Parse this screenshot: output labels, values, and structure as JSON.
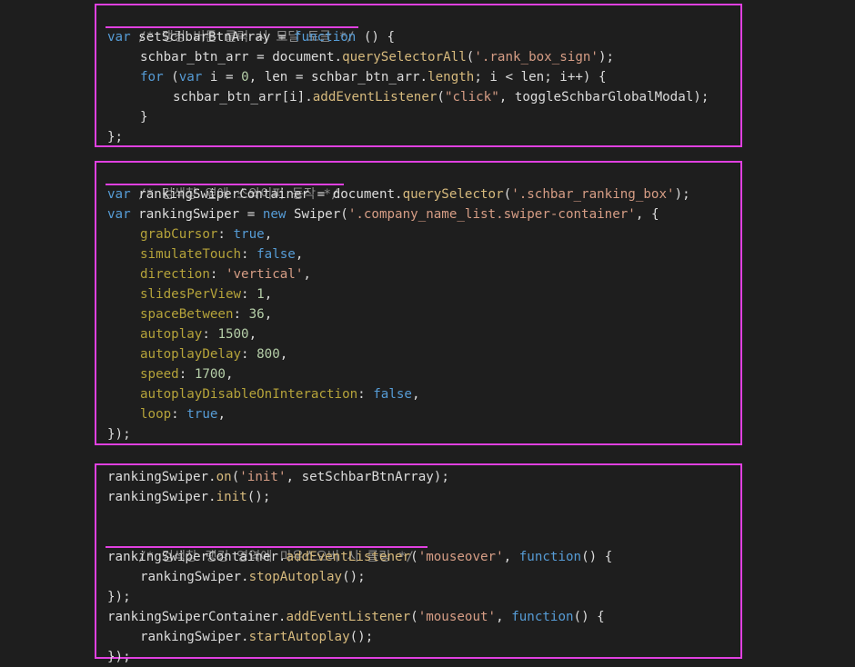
{
  "block1": {
    "comment": "/* 랭킹 버튼 클릭 시 모달 토글 */",
    "l1": {
      "kw": "var",
      "text": " setSchbarBtnArray = ",
      "kw2": "function",
      "rest": " () {"
    },
    "l2": {
      "a": "schbar_btn_arr = document.",
      "m": "querySelectorAll",
      "b": "(",
      "s": "'.rank_box_sign'",
      "c": ");"
    },
    "l3": {
      "kw": "for",
      "a": " (",
      "kw2": "var",
      "b": " i = ",
      "n": "0",
      "c": ", len = schbar_btn_arr.",
      "m": "length",
      "d": "; i < len; i++) {"
    },
    "l4": {
      "a": "schbar_btn_arr[i].",
      "m": "addEventListener",
      "b": "(",
      "s": "\"click\"",
      "c": ", toggleSchbarGlobalModal);"
    },
    "l5": "}",
    "l6": "};"
  },
  "block2": {
    "comment": "/* 검색창 옆에 스와이퍼 동작 */",
    "l1": {
      "kw": "var",
      "a": " rankingSwiperContainer = document.",
      "m": "querySelector",
      "b": "(",
      "s": "'.schbar_ranking_box'",
      "c": ");"
    },
    "l2": {
      "kw": "var",
      "a": " rankingSwiper = ",
      "kw2": "new",
      "b": " Swiper(",
      "s": "'.company_name_list.swiper-container'",
      "c": ", {"
    },
    "props": [
      {
        "key": "grabCursor",
        "val": "true",
        "type": "kw"
      },
      {
        "key": "simulateTouch",
        "val": "false",
        "type": "kw"
      },
      {
        "key": "direction",
        "val": "'vertical'",
        "type": "str"
      },
      {
        "key": "slidesPerView",
        "val": "1",
        "type": "num"
      },
      {
        "key": "spaceBetween",
        "val": "36",
        "type": "num"
      },
      {
        "key": "autoplay",
        "val": "1500",
        "type": "num"
      },
      {
        "key": "autoplayDelay",
        "val": "800",
        "type": "num"
      },
      {
        "key": "speed",
        "val": "1700",
        "type": "num"
      },
      {
        "key": "autoplayDisableOnInteraction",
        "val": "false",
        "type": "kw"
      },
      {
        "key": "loop",
        "val": "true",
        "type": "kw"
      }
    ],
    "close": "});"
  },
  "block3": {
    "l1": {
      "a": "rankingSwiper.",
      "m": "on",
      "b": "(",
      "s": "'init'",
      "c": ", setSchbarBtnArray);"
    },
    "l2": {
      "a": "rankingSwiper.",
      "m": "init",
      "b": "();"
    },
    "comment": "/* 검색창 랭킹 영역에 마우스오버 시 롤링 */",
    "l4": {
      "a": "rankingSwiperContainer.",
      "m": "addEventListener",
      "b": "(",
      "s": "'mouseover'",
      "c": ", ",
      "kw": "function",
      "d": "() {"
    },
    "l5": {
      "a": "rankingSwiper.",
      "m": "stopAutoplay",
      "b": "();"
    },
    "l6": "});",
    "l7": {
      "a": "rankingSwiperContainer.",
      "m": "addEventListener",
      "b": "(",
      "s": "'mouseout'",
      "c": ", ",
      "kw": "function",
      "d": "() {"
    },
    "l8": {
      "a": "rankingSwiper.",
      "m": "startAutoplay",
      "b": "();"
    },
    "l9": "});"
  },
  "colors": {
    "highlight": "#e040e0",
    "background": "#1e1e1e",
    "comment": "#8a8a8a",
    "keyword": "#569cd6",
    "string": "#d69d85",
    "property": "#b5a33a",
    "method": "#d7ba7d",
    "number": "#b5cea8"
  }
}
